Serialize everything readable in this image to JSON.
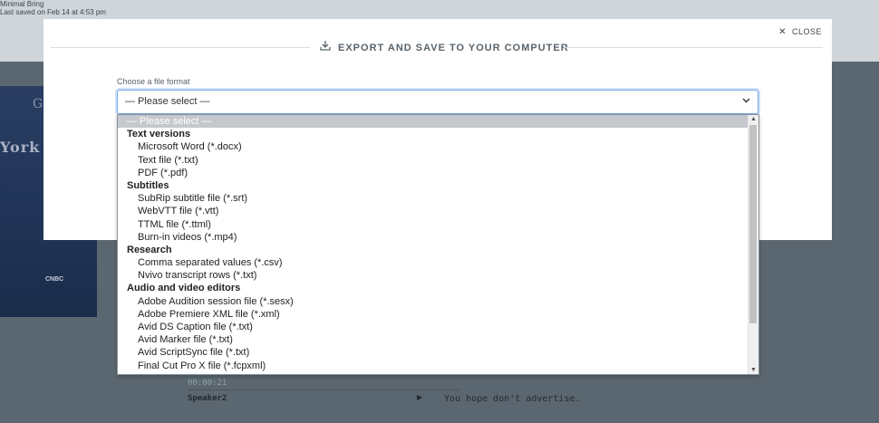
{
  "background": {
    "saved_text": "Last saved on Feb 14 at 4:53 pm",
    "top_fragment": "Minimal Bring",
    "timestamp": "00:00:21",
    "speaker": "Speaker2",
    "transcript_line": "You hope don't advertise.",
    "video_logo_left": "York T",
    "video_logo_top": "G",
    "video_network": "CNBC"
  },
  "modal": {
    "title": "EXPORT AND SAVE TO YOUR COMPUTER",
    "close_label": "CLOSE",
    "field_label": "Choose a file format",
    "selected_value": "— Please select —"
  },
  "dropdown": {
    "placeholder": "— Please select —",
    "groups": [
      {
        "label": "Text versions",
        "options": [
          "Microsoft Word (*.docx)",
          "Text file (*.txt)",
          "PDF (*.pdf)"
        ]
      },
      {
        "label": "Subtitles",
        "options": [
          "SubRip subtitle file (*.srt)",
          "WebVTT file (*.vtt)",
          "TTML file (*.ttml)",
          "Burn-in videos (*.mp4)"
        ]
      },
      {
        "label": "Research",
        "options": [
          "Comma separated values (*.csv)",
          "Nvivo transcript rows (*.txt)"
        ]
      },
      {
        "label": "Audio and video editors",
        "options": [
          "Adobe Audition session file (*.sesx)",
          "Adobe Premiere XML file (*.xml)",
          "Avid DS Caption file (*.txt)",
          "Avid Marker file (*.txt)",
          "Avid ScriptSync file (*.txt)",
          "Final Cut Pro X file (*.fcpxml)"
        ]
      }
    ]
  },
  "icons": {
    "download": "download-icon",
    "close": "close-icon",
    "chevron": "chevron-down-icon"
  }
}
